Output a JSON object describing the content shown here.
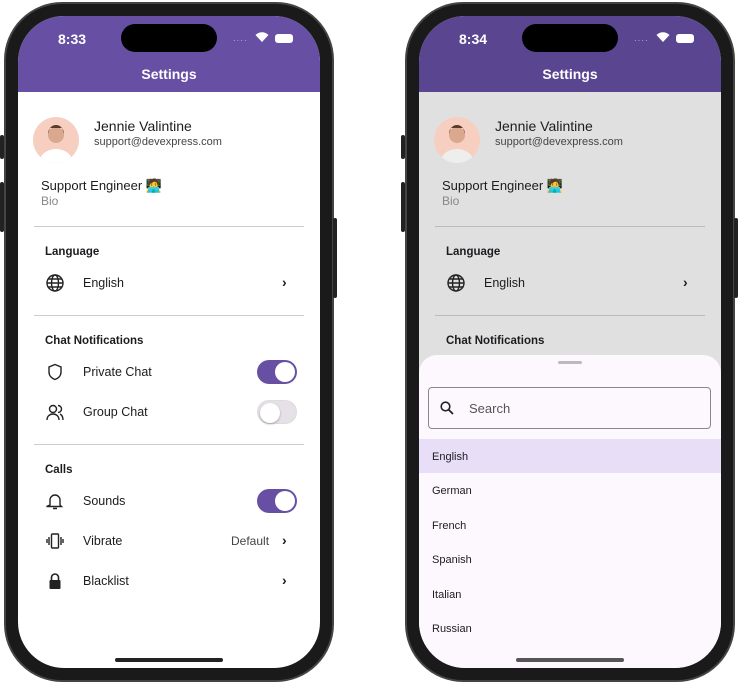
{
  "colors": {
    "primary": "#6750a4",
    "selected": "#e8def8",
    "sheet": "#fdf8fd"
  },
  "left": {
    "time": "8:33"
  },
  "right": {
    "time": "8:34"
  },
  "header": {
    "title": "Settings"
  },
  "profile": {
    "name": "Jennie Valintine",
    "email": "support@devexpress.com",
    "role": "Support Engineer 🧑‍💻",
    "bio": "Bio"
  },
  "language": {
    "section": "Language",
    "value": "English",
    "icon": "globe-icon"
  },
  "chat": {
    "section": "Chat Notifications",
    "items": [
      {
        "label": "Private Chat",
        "icon": "shield-icon",
        "on": true
      },
      {
        "label": "Group Chat",
        "icon": "users-icon",
        "on": false
      }
    ]
  },
  "calls": {
    "section": "Calls",
    "items": [
      {
        "label": "Sounds",
        "icon": "bell-icon",
        "on": true
      },
      {
        "label": "Vibrate",
        "icon": "vibrate-icon",
        "value": "Default"
      },
      {
        "label": "Blacklist",
        "icon": "lock-icon"
      }
    ]
  },
  "picker": {
    "search_placeholder": "Search",
    "options": [
      "English",
      "German",
      "French",
      "Spanish",
      "Italian",
      "Russian"
    ],
    "selected": "English"
  }
}
